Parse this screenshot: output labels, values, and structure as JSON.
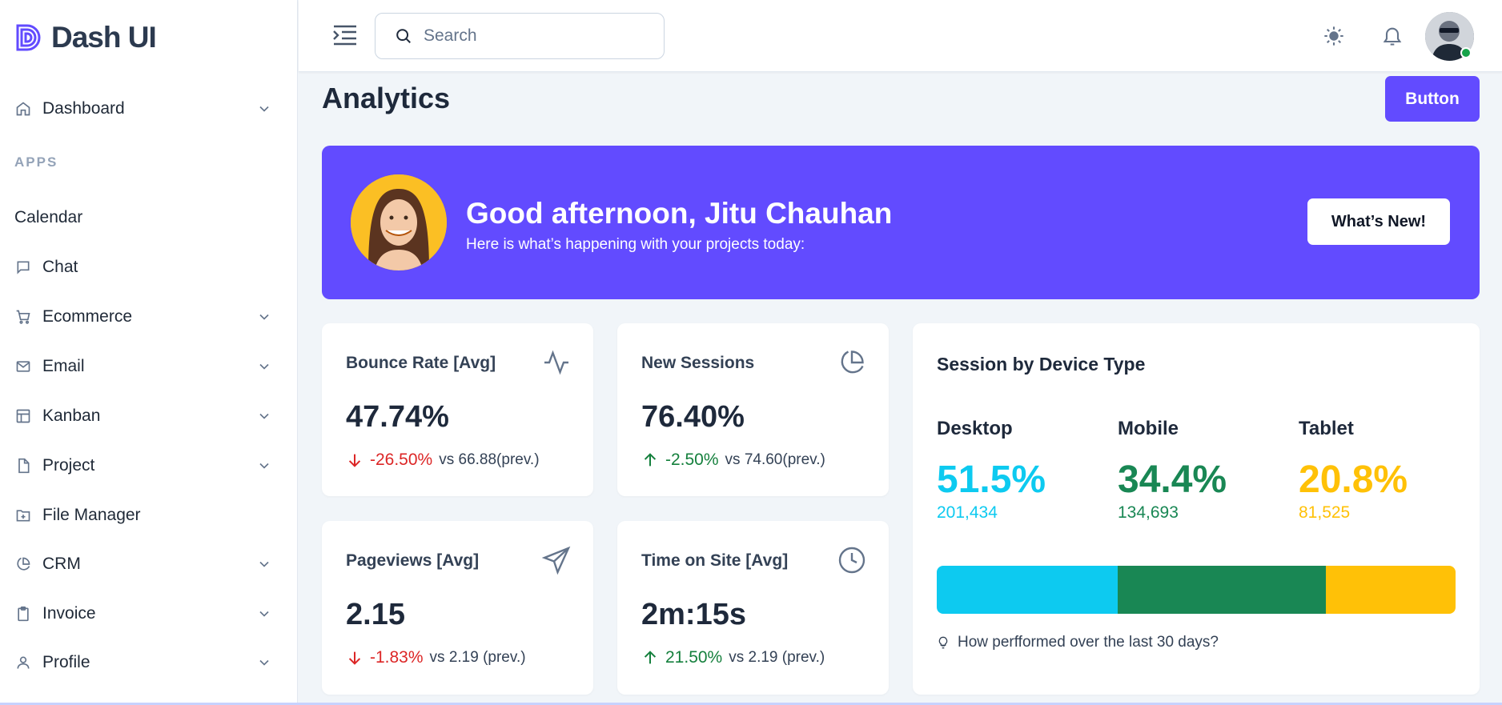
{
  "brand": {
    "name": "Dash UI",
    "accent": "#624bff"
  },
  "sidebar": {
    "section_label": "APPS",
    "items": [
      {
        "label": "Dashboard",
        "icon": "home-icon",
        "expandable": true
      },
      {
        "label": "Calendar",
        "icon": "",
        "expandable": false
      },
      {
        "label": "Chat",
        "icon": "message-square-icon",
        "expandable": false
      },
      {
        "label": "Ecommerce",
        "icon": "shopping-cart-icon",
        "expandable": true
      },
      {
        "label": "Email",
        "icon": "mail-icon",
        "expandable": true
      },
      {
        "label": "Kanban",
        "icon": "layout-icon",
        "expandable": true
      },
      {
        "label": "Project",
        "icon": "file-icon",
        "expandable": true
      },
      {
        "label": "File Manager",
        "icon": "folder-plus-icon",
        "expandable": false
      },
      {
        "label": "CRM",
        "icon": "pie-chart-icon",
        "expandable": true
      },
      {
        "label": "Invoice",
        "icon": "clipboard-icon",
        "expandable": true
      },
      {
        "label": "Profile",
        "icon": "user-icon",
        "expandable": true
      }
    ]
  },
  "header": {
    "search_placeholder": "Search",
    "status": "online"
  },
  "page": {
    "title": "Analytics",
    "action_label": "Button"
  },
  "hero": {
    "greeting": "Good afternoon, Jitu Chauhan",
    "subtitle": "Here is what’s happening with your projects today:",
    "button_label": "What’s New!"
  },
  "stats": [
    {
      "label": "Bounce Rate [Avg]",
      "icon": "activity-icon",
      "value": "47.74%",
      "delta": "-26.50%",
      "direction": "down",
      "prev": "vs 66.88(prev.)"
    },
    {
      "label": "New Sessions",
      "icon": "pie-chart-icon",
      "value": "76.40%",
      "delta": "-2.50%",
      "direction": "up",
      "prev": "vs 74.60(prev.)"
    },
    {
      "label": "Pageviews [Avg]",
      "icon": "send-icon",
      "value": "2.15",
      "delta": "-1.83%",
      "direction": "down",
      "prev": "vs 2.19 (prev.)"
    },
    {
      "label": "Time on Site [Avg]",
      "icon": "clock-icon",
      "value": "2m:15s",
      "delta": "21.50%",
      "direction": "up",
      "prev": "vs 2.19 (prev.)"
    }
  ],
  "device_card": {
    "title": "Session by Device Type",
    "devices": [
      {
        "name": "Desktop",
        "pct": "51.5%",
        "count": "201,434",
        "share": 0.348,
        "color": "#0dcaf0"
      },
      {
        "name": "Mobile",
        "pct": "34.4%",
        "count": "134,693",
        "share": 0.402,
        "color": "#198754"
      },
      {
        "name": "Tablet",
        "pct": "20.8%",
        "count": "81,525",
        "share": 0.25,
        "color": "#ffc107"
      }
    ],
    "note": "How perfformed over the last 30 days?"
  },
  "colors": {
    "danger": "#dc2626",
    "success": "#15803d",
    "page_bg": "#f1f5f9"
  }
}
